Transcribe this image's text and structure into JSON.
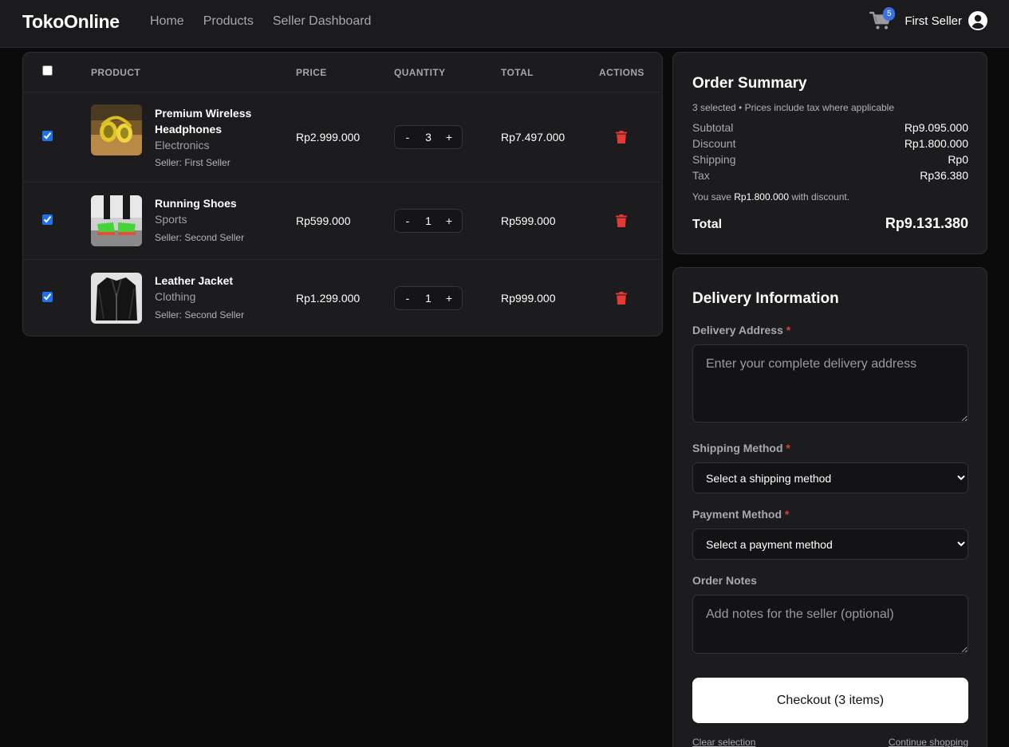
{
  "brand": "TokoOnline",
  "nav": {
    "links": [
      "Home",
      "Products",
      "Seller Dashboard"
    ]
  },
  "header": {
    "cart_count": "5",
    "user_name": "First Seller",
    "cart_icon": "cart-icon",
    "avatar_icon": "user-circle-icon"
  },
  "table": {
    "headers": {
      "product": "PRODUCT",
      "price": "PRICE",
      "quantity": "QUANTITY",
      "total": "TOTAL",
      "actions": "ACTIONS"
    },
    "rows": [
      {
        "name": "Premium Wireless Headphones",
        "category": "Electronics",
        "seller": "Seller: First Seller",
        "price": "Rp2.999.000",
        "qty": "3",
        "total": "Rp7.497.000",
        "selected": true
      },
      {
        "name": "Running Shoes",
        "category": "Sports",
        "seller": "Seller: Second Seller",
        "price": "Rp599.000",
        "qty": "1",
        "total": "Rp599.000",
        "selected": true
      },
      {
        "name": "Leather Jacket",
        "category": "Clothing",
        "seller": "Seller: Second Seller",
        "price": "Rp1.299.000",
        "qty": "1",
        "total": "Rp999.000",
        "selected": true
      }
    ],
    "qty_minus": "-",
    "qty_plus": "+",
    "delete_icon": "trash-icon",
    "delete_color": "#e53935"
  },
  "summary": {
    "title": "Order Summary",
    "subtitle": "3 selected • Prices include tax where applicable",
    "lines": [
      {
        "label": "Subtotal",
        "value": "Rp9.095.000"
      },
      {
        "label": "Discount",
        "value": "Rp1.800.000"
      },
      {
        "label": "Shipping",
        "value": "Rp0"
      },
      {
        "label": "Tax",
        "value": "Rp36.380"
      }
    ],
    "save_prefix": "You save ",
    "save_amount": "Rp1.800.000",
    "save_suffix": " with discount.",
    "total_label": "Total",
    "total_value": "Rp9.131.380"
  },
  "delivery": {
    "title": "Delivery Information",
    "address_label": "Delivery Address",
    "address_placeholder": "Enter your complete delivery address",
    "shipping_label": "Shipping Method",
    "shipping_value": "Select a shipping method",
    "payment_label": "Payment Method",
    "payment_value": "Select a payment method",
    "notes_label": "Order Notes",
    "notes_placeholder": "Add notes for the seller (optional)",
    "required_mark": "*",
    "checkout_label": "Checkout (3 items)",
    "clear_label": "Clear selection",
    "continue_label": "Continue shopping"
  },
  "colors": {
    "background": "#0b0b0c",
    "card": "#1c1c1e",
    "accent": "#3a6fe0",
    "danger": "#e53935"
  }
}
